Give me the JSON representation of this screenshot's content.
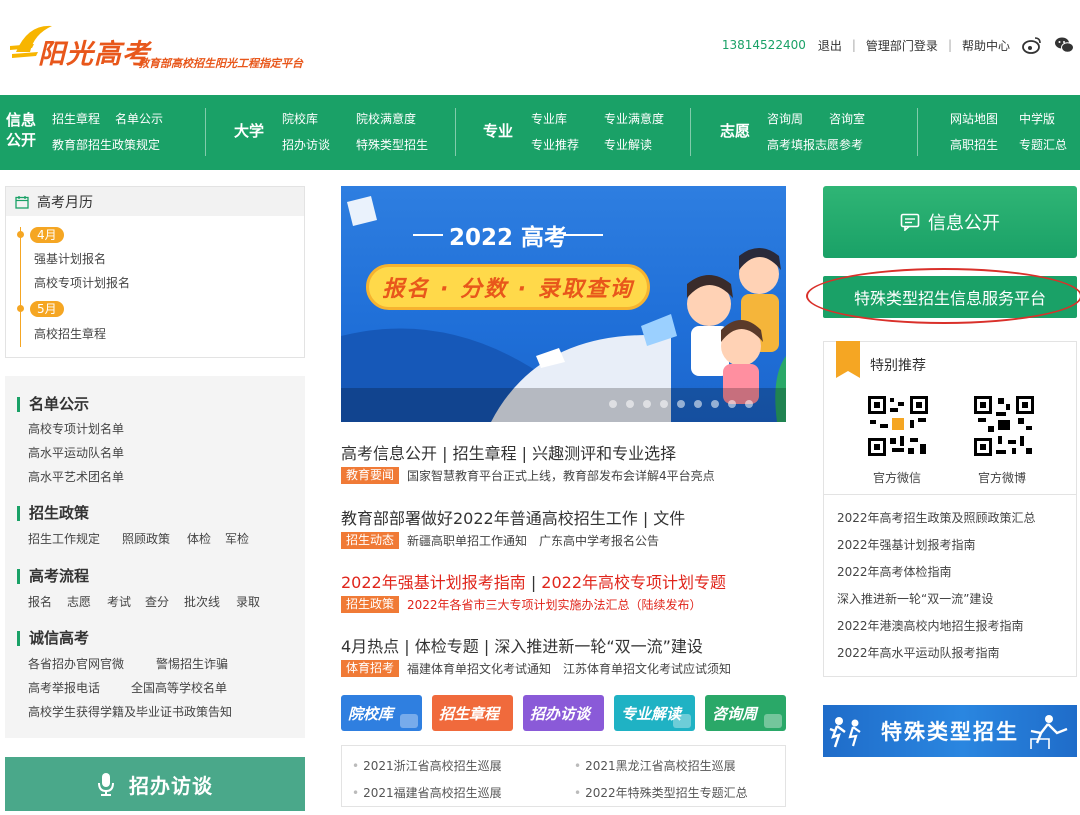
{
  "header": {
    "logo_main": "阳光高考",
    "logo_sub": "教育部高校招生阳光工程指定平台",
    "phone": "13814522400",
    "logout": "退出",
    "admin_login": "管理部门登录",
    "help": "帮助中心",
    "icons": [
      "weibo-icon",
      "wechat-icon"
    ]
  },
  "nav": {
    "info_title": "信息公开",
    "info_links": [
      "招生章程",
      "名单公示",
      "教育部招生政策规定"
    ],
    "uni_title": "大学",
    "uni_links": [
      "院校库",
      "院校满意度",
      "招办访谈",
      "特殊类型招生"
    ],
    "major_title": "专业",
    "major_links": [
      "专业库",
      "专业满意度",
      "专业推荐",
      "专业解读"
    ],
    "wish_title": "志愿",
    "wish_links": [
      "咨询周",
      "咨询室",
      "高考填报志愿参考"
    ],
    "other_links": [
      "网站地图",
      "中学版",
      "高职招生",
      "专题汇总"
    ]
  },
  "calendar": {
    "title": "高考月历",
    "months": [
      {
        "label": "4月",
        "items": [
          "强基计划报名",
          "高校专项计划报名"
        ]
      },
      {
        "label": "5月",
        "items": [
          "高校招生章程"
        ]
      }
    ]
  },
  "left_lists": [
    {
      "title": "名单公示",
      "items": [
        "高校专项计划名单",
        "高水平运动队名单",
        "高水平艺术团名单"
      ]
    },
    {
      "title": "招生政策",
      "items": [
        "招生工作规定",
        "照顾政策",
        "体检",
        "军检"
      ]
    },
    {
      "title": "高考流程",
      "items": [
        "报名",
        "志愿",
        "考试",
        "查分",
        "批次线",
        "录取"
      ]
    },
    {
      "title": "诚信高考",
      "items": [
        "各省招办官网官微",
        "警惕招生诈骗",
        "高考举报电话",
        "全国高等学校名单",
        "高校学生获得学籍及毕业证书政策告知"
      ]
    }
  ],
  "interview_button": "招办访谈",
  "banner": {
    "title": "2022 高考",
    "pill": "报名 · 分数 · 录取查询"
  },
  "news": [
    {
      "headline": [
        "高考信息公开",
        "招生章程",
        "兴趣测评和专业选择"
      ],
      "tag": "教育要闻",
      "items": [
        "国家智慧教育平台正式上线，教育部发布会详解4平台亮点"
      ],
      "red": false
    },
    {
      "headline": [
        "教育部部署做好2022年普通高校招生工作",
        "文件"
      ],
      "tag": "招生动态",
      "items": [
        "新疆高职单招工作通知",
        "广东高中学考报名公告"
      ],
      "red": false
    },
    {
      "headline": [
        "2022年强基计划报考指南",
        "2022年高校专项计划专题"
      ],
      "tag": "招生政策",
      "items": [
        "2022年各省市三大专项计划实施办法汇总（陆续发布）"
      ],
      "red": true
    },
    {
      "headline": [
        "4月热点",
        "体检专题",
        "深入推进新一轮“双一流”建设"
      ],
      "tag": "体育招考",
      "items": [
        "福建体育单招文化考试通知",
        "江苏体育单招文化考试应试须知"
      ],
      "red": false
    }
  ],
  "tiles": [
    {
      "label": "院校库",
      "color": "#2f7fe0"
    },
    {
      "label": "招生章程",
      "color": "#f06a3c"
    },
    {
      "label": "招办访谈",
      "color": "#8a5ad8"
    },
    {
      "label": "专业解读",
      "color": "#1fb2c4"
    },
    {
      "label": "咨询周",
      "color": "#2aa868"
    }
  ],
  "bottom_links": [
    "2021浙江省高校招生巡展",
    "2021黑龙江省高校招生巡展",
    "2021福建省高校招生巡展",
    "2022年特殊类型招生专题汇总"
  ],
  "right": {
    "info_button": "信息公开",
    "special_button": "特殊类型招生信息服务平台",
    "rec_title": "特别推荐",
    "qr_labels": [
      "官方微信",
      "官方微博"
    ],
    "rec_links": [
      "2022年高考招生政策及照顾政策汇总",
      "2022年强基计划报考指南",
      "2022年高考体检指南",
      "深入推进新一轮“双一流”建设",
      "2022年港澳高校内地招生报考指南",
      "2022年高水平运动队报考指南"
    ],
    "special_banner": "特殊类型招生"
  },
  "colors": {
    "brand_green": "#1aa167",
    "accent_orange": "#f5a623",
    "news_red": "#e0251b",
    "tag_orange": "#f07a36",
    "ring_red": "#d9302a"
  }
}
